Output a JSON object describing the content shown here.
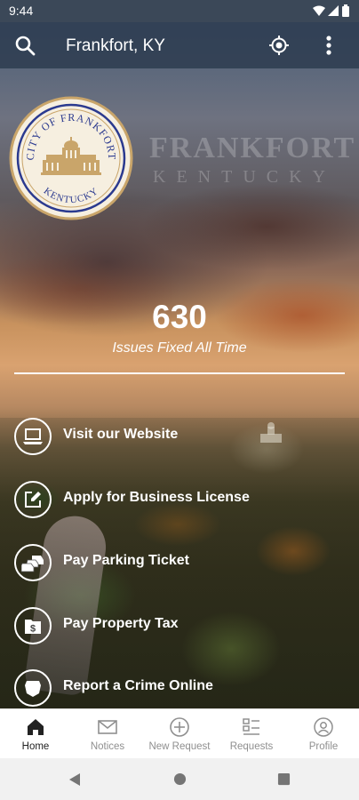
{
  "status_bar": {
    "time": "9:44",
    "icons": [
      "wifi-icon",
      "signal-icon",
      "battery-icon"
    ]
  },
  "app_bar": {
    "location": "Frankfort, KY",
    "icons": [
      "search-icon",
      "locate-icon",
      "more-vert-icon"
    ]
  },
  "seal": {
    "top_text": "CITY OF FRANKFORT",
    "bottom_text": "KENTUCKY"
  },
  "wordmark": {
    "line1": "FRANKFORT",
    "line2": "KENTUCKY"
  },
  "stats": {
    "count": "630",
    "label": "Issues Fixed All Time"
  },
  "links": [
    {
      "label": "Visit our Website",
      "icon": "laptop-icon"
    },
    {
      "label": "Apply for Business License",
      "icon": "edit-icon"
    },
    {
      "label": "Pay Parking Ticket",
      "icon": "cars-icon"
    },
    {
      "label": "Pay Property Tax",
      "icon": "dollar-folder-icon"
    },
    {
      "label": "Report a Crime Online",
      "icon": "police-badge-icon"
    }
  ],
  "bottom_nav": [
    {
      "label": "Home",
      "icon": "home-icon",
      "active": true
    },
    {
      "label": "Notices",
      "icon": "mail-icon",
      "active": false
    },
    {
      "label": "New Request",
      "icon": "plus-circle-icon",
      "active": false
    },
    {
      "label": "Requests",
      "icon": "list-icon",
      "active": false
    },
    {
      "label": "Profile",
      "icon": "profile-icon",
      "active": false
    }
  ],
  "colors": {
    "app_bar": "#2c3a4e",
    "seal_border": "#c9a56a",
    "seal_ring": "#2b3a8f",
    "nav_active": "#222222",
    "nav_inactive": "#8f8f8f"
  }
}
